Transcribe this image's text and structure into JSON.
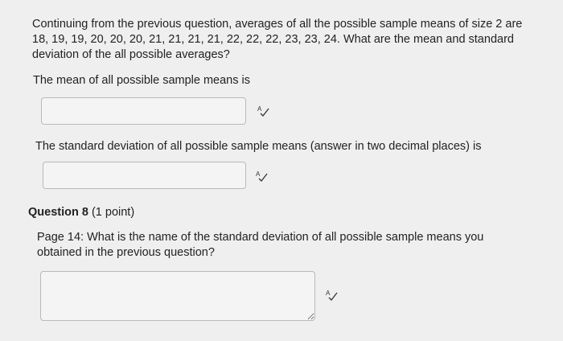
{
  "question7": {
    "prompt": "Continuing from the previous question, averages of all the possible sample means of size 2 are 18, 19, 19, 20, 20, 20, 21, 21, 21, 21, 22, 22, 22, 23, 23, 24. What are the mean and standard deviation of the all possible averages?",
    "mean_label": "The mean of all possible sample means is",
    "mean_value": "",
    "sd_label": "The standard deviation of all possible sample means (answer in two decimal places) is",
    "sd_value": ""
  },
  "question8": {
    "title": "Question 8",
    "points": "(1 point)",
    "prompt": "Page 14: What is the name of the standard deviation of all possible sample means you obtained in the previous question?",
    "answer_value": ""
  },
  "icons": {
    "spellcheck": "spellcheck-icon"
  }
}
